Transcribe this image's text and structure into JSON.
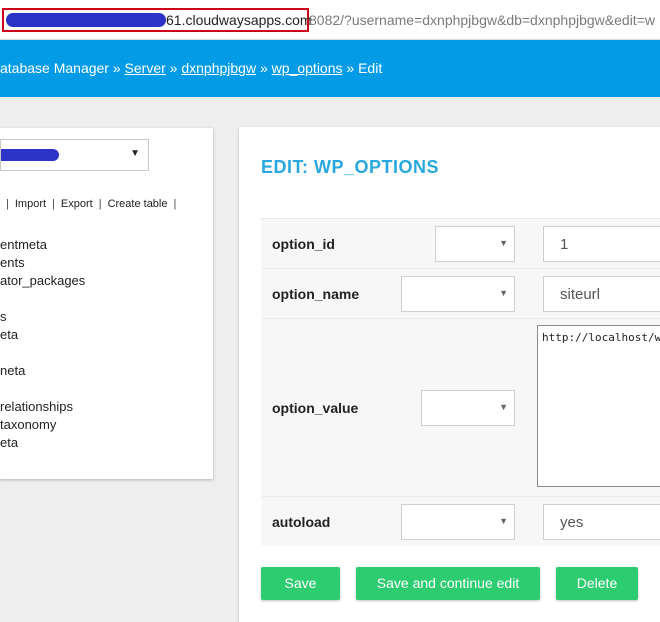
{
  "address_bar": {
    "domain": "61.cloudwaysapps.com",
    "rest": "8082/?username=dxnphpjbgw&db=dxnphpjbgw&edit=w"
  },
  "breadcrumb": {
    "root": "atabase Manager",
    "sep": "»",
    "server": "Server",
    "db": "dxnphpjbgw",
    "table": "wp_options",
    "current": "Edit"
  },
  "sidebar": {
    "links": [
      "Import",
      "Export",
      "Create table"
    ],
    "tables": [
      "entmeta",
      "ents",
      "ator_packages",
      "",
      "s",
      "eta",
      "",
      "neta",
      "",
      "relationships",
      "taxonomy",
      "eta"
    ]
  },
  "form": {
    "title": "EDIT: WP_OPTIONS",
    "fields": [
      {
        "label": "option_id",
        "value": "1"
      },
      {
        "label": "option_name",
        "value": "siteurl"
      },
      {
        "label": "option_value",
        "value": "http://localhost/wordp"
      },
      {
        "label": "autoload",
        "value": "yes"
      }
    ],
    "buttons": {
      "save": "Save",
      "save_continue": "Save and continue edit",
      "delete": "Delete"
    }
  },
  "colors": {
    "header": "#039be5",
    "title": "#29a8e0",
    "button": "#2ecc71",
    "highlight": "#d0021b",
    "redaction": "#2b33c9"
  }
}
